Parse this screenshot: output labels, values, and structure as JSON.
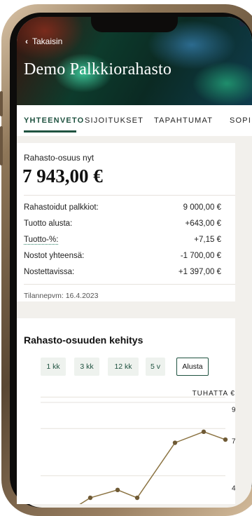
{
  "header": {
    "back_label": "Takaisin",
    "title": "Demo Palkkiorahasto"
  },
  "tabs": [
    {
      "label": "YHTEENVETO",
      "active": true
    },
    {
      "label": "SIJOITUKSET",
      "active": false
    },
    {
      "label": "TAPAHTUMAT",
      "active": false
    },
    {
      "label": "SOPI",
      "active": false
    }
  ],
  "summary": {
    "share_label": "Rahasto-osuus nyt",
    "share_value": "7 943,00 €",
    "rows": [
      {
        "label": "Rahastoidut palkkiot:",
        "value": "9 000,00 €"
      },
      {
        "label": "Tuotto alusta:",
        "value": "+643,00 €"
      },
      {
        "label": "Tuotto-%:",
        "value": "+7,15 €"
      },
      {
        "label": "Nostot yhteensä:",
        "value": "-1 700,00 €"
      },
      {
        "label": "Nostettavissa:",
        "value": "+1 397,00 €"
      }
    ],
    "date_label": "Tilannepvm: 16.4.2023"
  },
  "development": {
    "title": "Rahasto-osuuden kehitys",
    "ranges": [
      {
        "label": "1 kk",
        "active": false
      },
      {
        "label": "3 kk",
        "active": false
      },
      {
        "label": "12 kk",
        "active": false
      },
      {
        "label": "5 v",
        "active": false
      },
      {
        "label": "Alusta",
        "active": true
      }
    ],
    "unit_label": "TUHATTA €"
  },
  "chart_data": {
    "type": "line",
    "title": "Rahasto-osuuden kehitys",
    "ylabel": "TUHATTA €",
    "yticks": [
      9,
      7,
      4
    ],
    "ylim": [
      3,
      10
    ],
    "y": [
      2.7,
      3.4,
      3.9,
      3.4,
      6.9,
      7.6,
      7.1
    ],
    "grid": true,
    "line_color": "#8c7443",
    "marker_color": "#6f5a35"
  },
  "colors": {
    "accent": "#1f5240",
    "hero_dark": "#0b2a23"
  }
}
